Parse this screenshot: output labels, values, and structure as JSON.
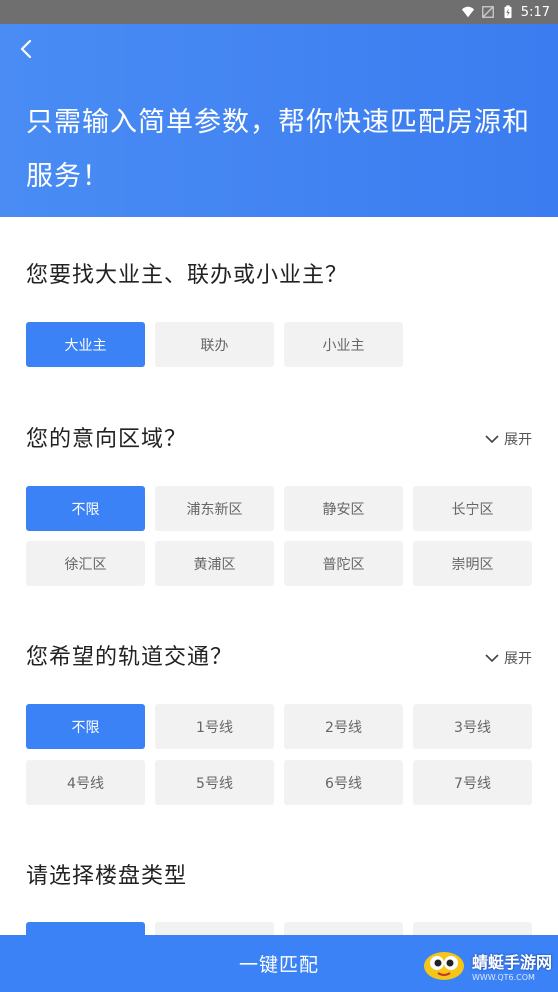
{
  "status_bar": {
    "time": "5:17"
  },
  "header": {
    "title": "只需输入简单参数，帮你快速匹配房源和服务！"
  },
  "sections": {
    "owner": {
      "title": "您要找大业主、联办或小业主？",
      "options": [
        "大业主",
        "联办",
        "小业主"
      ]
    },
    "area": {
      "title": "您的意向区域？",
      "expand": "展开",
      "options": [
        "不限",
        "浦东新区",
        "静安区",
        "长宁区",
        "徐汇区",
        "黄浦区",
        "普陀区",
        "崇明区"
      ]
    },
    "metro": {
      "title": "您希望的轨道交通？",
      "expand": "展开",
      "options": [
        "不限",
        "1号线",
        "2号线",
        "3号线",
        "4号线",
        "5号线",
        "6号线",
        "7号线"
      ]
    },
    "type": {
      "title": "请选择楼盘类型"
    }
  },
  "bottom": {
    "button": "一键匹配"
  },
  "watermark": {
    "main": "蜻蜓手游网",
    "sub": "WWW.QT6.COM"
  },
  "colors": {
    "accent": "#3b82f6",
    "chip_bg": "#f2f2f2"
  },
  "icons": [
    "wifi-icon",
    "signal-icon",
    "battery-icon",
    "back-arrow-icon",
    "chevron-down-icon"
  ]
}
